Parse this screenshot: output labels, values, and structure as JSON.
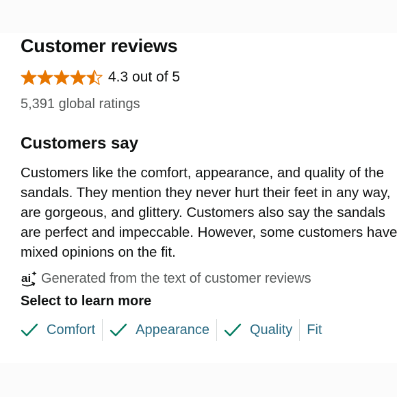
{
  "reviews": {
    "title": "Customer reviews",
    "rating": 4.3,
    "rating_text": "4.3 out of 5",
    "global_ratings": "5,391 global ratings",
    "star_color": "#e77600"
  },
  "customers_say": {
    "title": "Customers say",
    "summary": "Customers like the comfort, appearance, and quality of the sandals. They mention they never hurt their feet in any way, are gorgeous, and glittery. Customers also say the sandals are perfect and impeccable. However, some customers have mixed opinions on the fit.",
    "ai_icon": "ai-icon",
    "ai_icon_text": "ai",
    "generated_note": "Generated from the text of customer reviews",
    "select_label": "Select to learn more",
    "aspects": [
      {
        "label": "Comfort",
        "checked": true
      },
      {
        "label": "Appearance",
        "checked": true
      },
      {
        "label": "Quality",
        "checked": true
      },
      {
        "label": "Fit",
        "checked": false
      }
    ],
    "check_color": "#067d62",
    "link_color": "#2a6b84"
  }
}
